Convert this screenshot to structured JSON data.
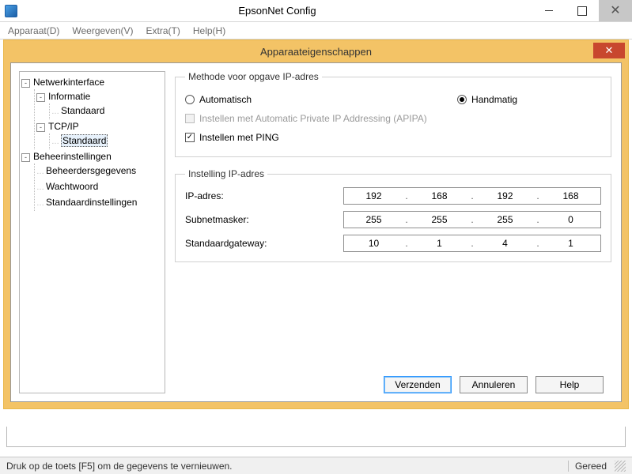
{
  "window": {
    "title": "EpsonNet Config"
  },
  "menu": {
    "apparaat": "Apparaat(D)",
    "weergeven": "Weergeven(V)",
    "extra": "Extra(T)",
    "help": "Help(H)"
  },
  "dialog": {
    "title": "Apparaateigenschappen"
  },
  "tree": {
    "netwerkinterface": "Netwerkinterface",
    "informatie": "Informatie",
    "informatie_standaard": "Standaard",
    "tcpip": "TCP/IP",
    "tcpip_standaard": "Standaard",
    "beheerinstellingen": "Beheerinstellingen",
    "beheerdersgegevens": "Beheerdersgegevens",
    "wachtwoord": "Wachtwoord",
    "standaardinstellingen": "Standaardinstellingen"
  },
  "group1": {
    "legend": "Methode voor opgave IP-adres",
    "radio_auto": "Automatisch",
    "radio_manual": "Handmatig",
    "selected": "manual",
    "apipa_label": "Instellen met Automatic Private IP Addressing (APIPA)",
    "apipa_checked": false,
    "apipa_enabled": false,
    "ping_label": "Instellen met PING",
    "ping_checked": true
  },
  "group2": {
    "legend": "Instelling IP-adres",
    "ip_label": "IP-adres:",
    "subnet_label": "Subnetmasker:",
    "gateway_label": "Standaardgateway:",
    "ip": [
      "192",
      "168",
      "192",
      "168"
    ],
    "subnet": [
      "255",
      "255",
      "255",
      "0"
    ],
    "gateway": [
      "10",
      "1",
      "4",
      "1"
    ]
  },
  "buttons": {
    "send": "Verzenden",
    "cancel": "Annuleren",
    "help": "Help"
  },
  "status": {
    "hint": "Druk op de toets [F5] om de gegevens te vernieuwen.",
    "ready": "Gereed"
  }
}
